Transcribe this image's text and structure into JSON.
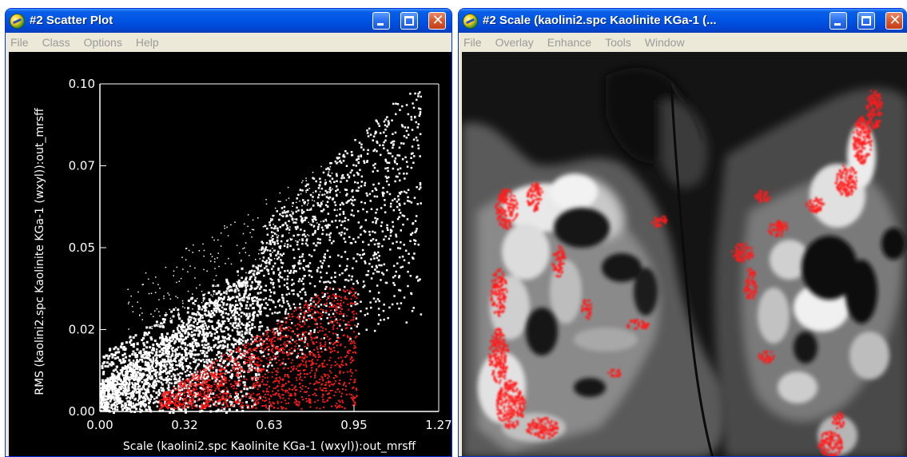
{
  "scatter_window": {
    "title": "#2 Scatter Plot",
    "menu": [
      "File",
      "Class",
      "Options",
      "Help"
    ]
  },
  "scale_window": {
    "title": "#2 Scale (kaolini2.spc Kaolinite KGa-1 (...",
    "menu": [
      "File",
      "Overlay",
      "Enhance",
      "Tools",
      "Window"
    ]
  },
  "colors": {
    "title_bar": "#0055e5",
    "plot_background": "#000000",
    "points": "#ffffff",
    "class_points": "#ff1a1a"
  },
  "chart_data": {
    "type": "scatter",
    "xlabel": "Scale (kaolini2.spc Kaolinite KGa-1 (wxyl)):out_mrsff",
    "ylabel": "RMS (kaolini2.spc Kaolinite KGa-1 (wxyl)):out_mrsff",
    "x_ticks": [
      "0.00",
      "0.32",
      "0.63",
      "0.95",
      "1.27"
    ],
    "y_ticks": [
      "0.00",
      "0.02",
      "0.05",
      "0.07",
      "0.10"
    ],
    "xlim": [
      0,
      1.27
    ],
    "ylim": [
      0,
      0.1
    ],
    "grid": false,
    "series": [
      {
        "color": "#ffffff",
        "description_points": [
          [
            0.02,
            0.003
          ],
          [
            0.05,
            0.008
          ],
          [
            0.1,
            0.012
          ],
          [
            0.2,
            0.02
          ],
          [
            0.35,
            0.03
          ],
          [
            0.5,
            0.04
          ],
          [
            0.65,
            0.052
          ],
          [
            0.8,
            0.065
          ],
          [
            0.95,
            0.078
          ],
          [
            1.05,
            0.085
          ],
          [
            1.18,
            0.095
          ]
        ]
      },
      {
        "color": "#ff1a1a",
        "description_points": [
          [
            0.2,
            0.001
          ],
          [
            0.35,
            0.005
          ],
          [
            0.5,
            0.01
          ],
          [
            0.65,
            0.016
          ],
          [
            0.8,
            0.022
          ],
          [
            0.9,
            0.028
          ],
          [
            0.95,
            0.036
          ]
        ]
      }
    ]
  }
}
